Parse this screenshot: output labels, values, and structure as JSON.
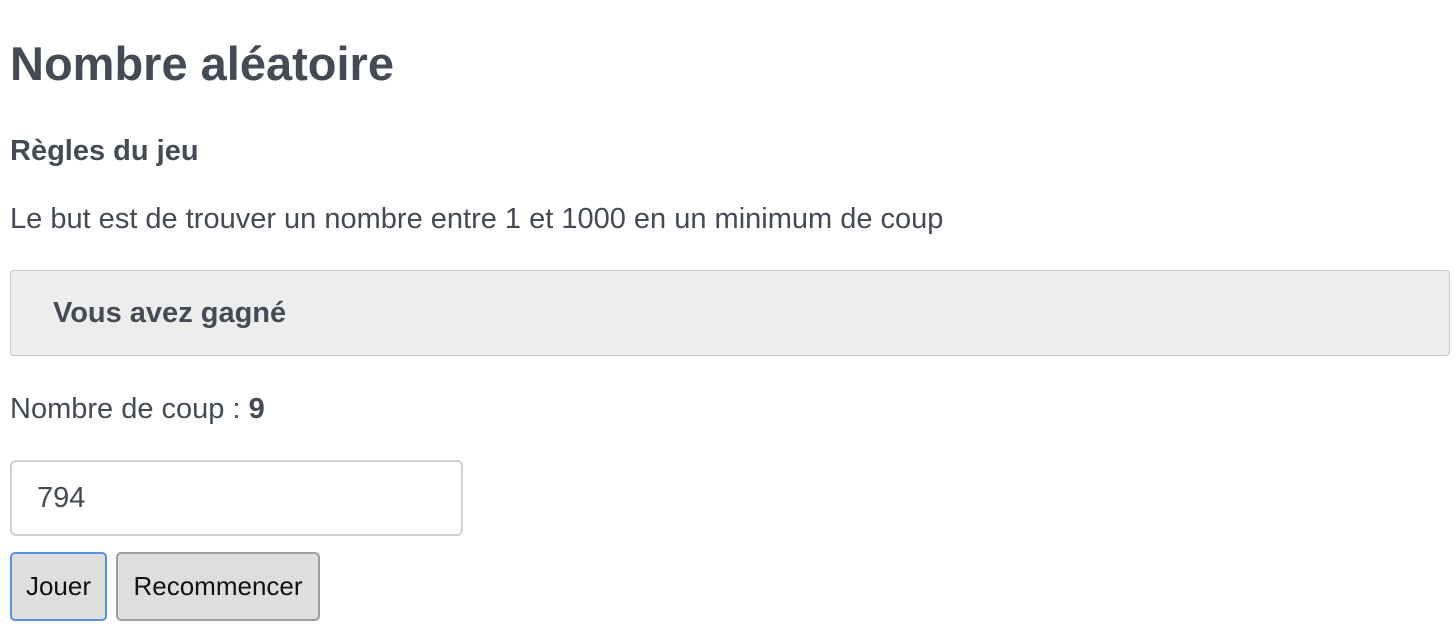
{
  "page": {
    "title": "Nombre aléatoire",
    "rules_heading": "Règles du jeu",
    "rules_text": "Le but est de trouver un nombre entre 1 et 1000 en un minimum de coup"
  },
  "result": {
    "message": "Vous avez gagné"
  },
  "count": {
    "label": "Nombre de coup : ",
    "value": "9"
  },
  "guess_input": {
    "value": "794"
  },
  "buttons": {
    "play_label": "Jouer",
    "restart_label": "Recommencer"
  },
  "colors": {
    "text": "#444b54",
    "result_background": "#ededed",
    "button_background": "#dedede",
    "focus_border": "#5b8ee0"
  }
}
